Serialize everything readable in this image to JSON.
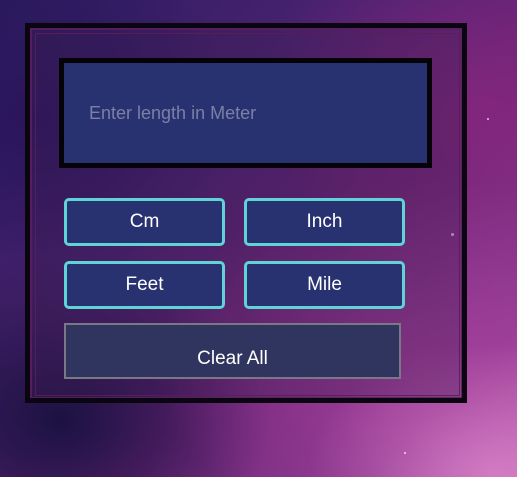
{
  "converter": {
    "input": {
      "placeholder": "Enter length in Meter",
      "value": ""
    },
    "units": [
      {
        "label": "Cm"
      },
      {
        "label": "Inch"
      },
      {
        "label": "Feet"
      },
      {
        "label": "Mile"
      }
    ],
    "clear_label": "Clear All"
  },
  "colors": {
    "display_bg": "#283270",
    "button_border": "#5fd3d6",
    "frame_border": "#0a0610",
    "clear_bg": "#303560"
  }
}
